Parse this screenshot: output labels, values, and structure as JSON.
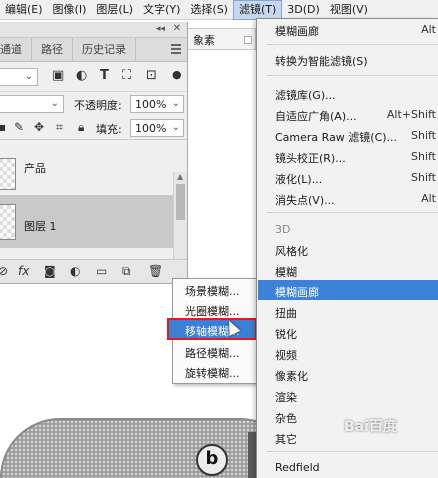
{
  "menubar": {
    "items": [
      "编辑(E)",
      "图像(I)",
      "图层(L)",
      "文字(Y)",
      "选择(S)",
      "滤镜(T)",
      "3D(D)",
      "视图(V)"
    ]
  },
  "options_bar": {
    "partial_label": "象素"
  },
  "panel": {
    "tabs": [
      "通道",
      "路径",
      "历史记录"
    ],
    "opacity_label": "不透明度:",
    "opacity_value": "100%",
    "fill_label": "填充:",
    "fill_value": "100%",
    "layers": [
      "产品",
      "图层 1"
    ]
  },
  "submenu": {
    "items": [
      "场景模糊...",
      "光圈模糊...",
      "移轴模糊...",
      "路径模糊...",
      "旋转模糊..."
    ]
  },
  "filter_menu": {
    "items": [
      {
        "label": "模糊画廊",
        "shortcut": "Alt"
      },
      {
        "label": "转换为智能滤镜(S)",
        "shortcut": ""
      },
      {
        "label": "滤镜库(G)...",
        "shortcut": ""
      },
      {
        "label": "自适应广角(A)...",
        "shortcut": "Alt+Shift"
      },
      {
        "label": "Camera Raw 滤镜(C)...",
        "shortcut": "Shift"
      },
      {
        "label": "镜头校正(R)...",
        "shortcut": "Shift"
      },
      {
        "label": "液化(L)...",
        "shortcut": "Shift"
      },
      {
        "label": "消失点(V)...",
        "shortcut": "Alt"
      },
      {
        "label": "3D",
        "shortcut": ""
      },
      {
        "label": "风格化",
        "shortcut": ""
      },
      {
        "label": "模糊",
        "shortcut": ""
      },
      {
        "label": "模糊画廊",
        "shortcut": ""
      },
      {
        "label": "扭曲",
        "shortcut": ""
      },
      {
        "label": "锐化",
        "shortcut": ""
      },
      {
        "label": "视频",
        "shortcut": ""
      },
      {
        "label": "像素化",
        "shortcut": ""
      },
      {
        "label": "渲染",
        "shortcut": ""
      },
      {
        "label": "杂色",
        "shortcut": ""
      },
      {
        "label": "其它",
        "shortcut": ""
      },
      {
        "label": "Redfield",
        "shortcut": ""
      }
    ]
  },
  "canvas": {
    "logo_letter": "b",
    "watermark": "Bai百度"
  },
  "colors": {
    "highlight": "#3c82d6",
    "red_box": "#e01c1c"
  }
}
